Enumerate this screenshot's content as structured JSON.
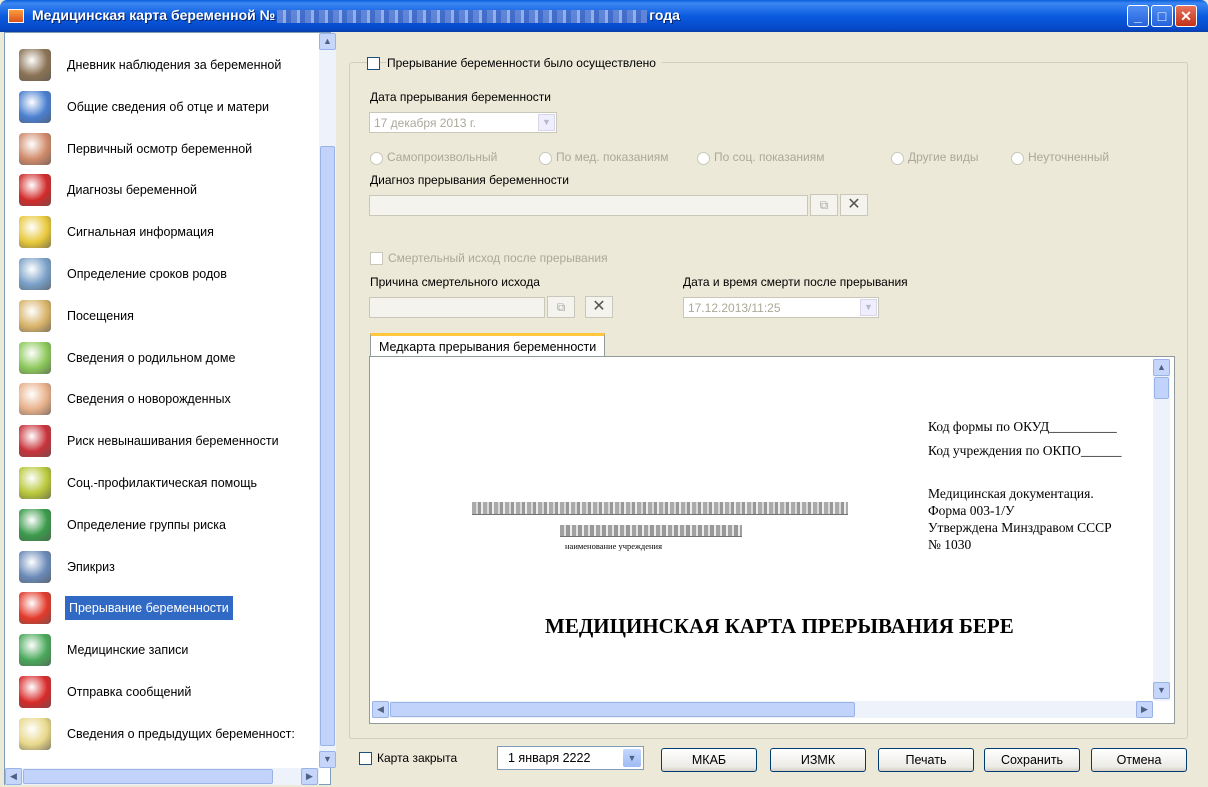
{
  "window": {
    "title_prefix": "Медицинская карта беременной №",
    "title_suffix": "года",
    "buttons": [
      "_",
      "□",
      "✕"
    ]
  },
  "sidebar": {
    "items": [
      {
        "label": "Дневник наблюдения за беременной",
        "icon": "diary-icon",
        "color": "#8b7355"
      },
      {
        "label": "Общие сведения об отце и матери",
        "icon": "contact-card-icon",
        "color": "#4a7fd0"
      },
      {
        "label": "Первичный осмотр беременной",
        "icon": "pregnant-woman-icon",
        "color": "#d08a6a"
      },
      {
        "label": "Диагнозы беременной",
        "icon": "medical-cross-icon",
        "color": "#d22a2a"
      },
      {
        "label": "Сигнальная информация",
        "icon": "notes-icon",
        "color": "#e8c83a"
      },
      {
        "label": "Определение сроков родов",
        "icon": "calendar-icon",
        "color": "#7aa0c8"
      },
      {
        "label": "Посещения",
        "icon": "card-file-icon",
        "color": "#d8b36a"
      },
      {
        "label": "Сведения о родильном доме",
        "icon": "baby-face-icon",
        "color": "#8cc85a"
      },
      {
        "label": "Сведения о новорожденных",
        "icon": "newborn-icon",
        "color": "#e8b08a"
      },
      {
        "label": "Риск невынашивания беременности",
        "icon": "risk-icon",
        "color": "#c8323a"
      },
      {
        "label": "Соц.-профилактическая помощь",
        "icon": "leaf-icon",
        "color": "#b8c83a"
      },
      {
        "label": "Определение группы риска",
        "icon": "shapes-icon",
        "color": "#3a9a4a"
      },
      {
        "label": "Эпикриз",
        "icon": "pen-icon",
        "color": "#6a8ab8"
      },
      {
        "label": "Прерывание беременности",
        "icon": "stop-hand-icon",
        "color": "#e23a2a"
      },
      {
        "label": "Медицинские записи",
        "icon": "records-icon",
        "color": "#4aa85a"
      },
      {
        "label": "Отправка сообщений",
        "icon": "mail-icon",
        "color": "#d82a2a"
      },
      {
        "label": "Сведения о предыдущих беременност:",
        "icon": "notepad-icon",
        "color": "#e8d88a"
      }
    ],
    "selected_index": 13
  },
  "form": {
    "termination_checkbox": "Прерывание беременности было осуществлено",
    "termination_date_label": "Дата прерывания беременности",
    "termination_date_value": "17 декабря  2013 г.",
    "radios": [
      "Самопроизвольный",
      "По мед. показаниям",
      "По соц. показаниям",
      "Другие виды",
      "Неуточненный"
    ],
    "diagnosis_label": "Диагноз прерывания беременности",
    "death_checkbox": "Смертельный исход после прерывания",
    "death_cause_label": "Причина смертельного исхода",
    "death_datetime_label": "Дата и время смерти после прерывания",
    "death_datetime_value": "17.12.2013/11:25"
  },
  "tab": {
    "label": "Медкарта прерывания беременности"
  },
  "document": {
    "okud": "Код формы по ОКУД__________",
    "okpo": "Код учреждения по ОКПО______",
    "med_doc": "Медицинская документация.",
    "form_no": "Форма 003-1/У",
    "approved": "Утверждена Минздравом СССР",
    "number": "№ 1030",
    "institution_caption": "наименование учреждения",
    "heading": "МЕДИЦИНСКАЯ КАРТА ПРЕРЫВАНИЯ БЕРЕ"
  },
  "footer": {
    "closed_checkbox": "Карта закрыта",
    "date_value": "1  января  2222",
    "buttons": {
      "mkab": "МКАБ",
      "izmk": "ИЗМК",
      "print": "Печать",
      "save": "Сохранить",
      "cancel": "Отмена"
    }
  }
}
